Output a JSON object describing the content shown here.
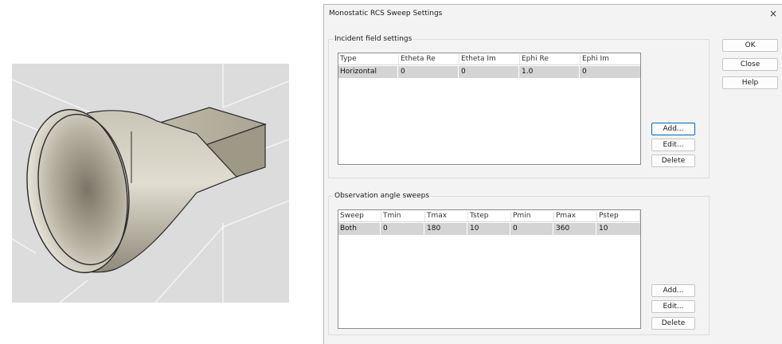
{
  "dialog": {
    "title": "Monostatic RCS Sweep Settings",
    "close_glyph": "×",
    "buttons": {
      "ok": "OK",
      "close": "Close",
      "help": "Help"
    }
  },
  "incident": {
    "group_label": "Incident field settings",
    "columns": [
      "Type",
      "Etheta Re",
      "Etheta Im",
      "Ephi Re",
      "Ephi Im"
    ],
    "rows": [
      [
        "Horizontal",
        "0",
        "0",
        "1.0",
        "0"
      ]
    ],
    "buttons": {
      "add": "Add...",
      "edit": "Edit...",
      "delete": "Delete"
    }
  },
  "observation": {
    "group_label": "Observation angle sweeps",
    "columns": [
      "Sweep",
      "Tmin",
      "Tmax",
      "Tstep",
      "Pmin",
      "Pmax",
      "Pstep"
    ],
    "rows": [
      [
        "Both",
        "0",
        "180",
        "10",
        "0",
        "360",
        "10"
      ]
    ],
    "buttons": {
      "add": "Add...",
      "edit": "Edit...",
      "delete": "Delete"
    }
  },
  "viewport": {
    "model": "horn-antenna",
    "colors": {
      "background": "#dcdcdc",
      "metal": "#b3ae9e",
      "edge": "#2a2a2a"
    }
  }
}
